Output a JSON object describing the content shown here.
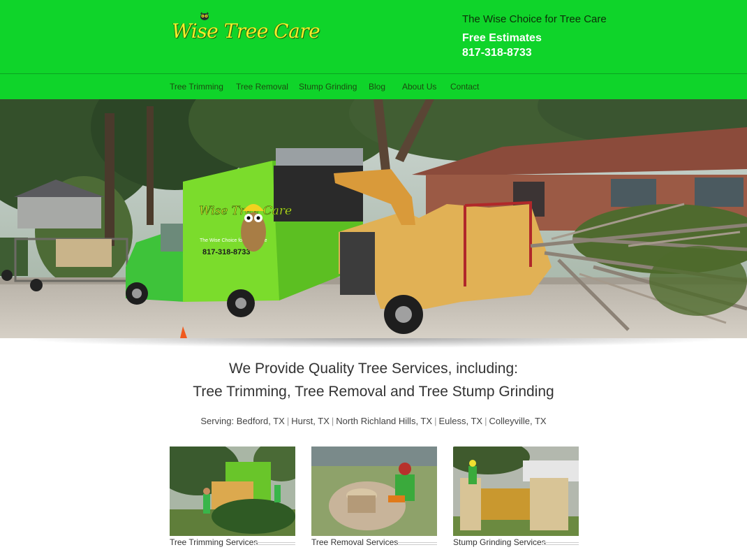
{
  "header": {
    "logo_text": "Wise Tree Care",
    "tagline": "The Wise Choice for Tree Care",
    "estimates": "Free Estimates",
    "phone": "817-318-8733"
  },
  "nav": {
    "items": [
      {
        "label": "Tree Trimming"
      },
      {
        "label": "Tree Removal"
      },
      {
        "label": "Stump Grinding"
      },
      {
        "label": "Blog"
      },
      {
        "label": "About Us"
      },
      {
        "label": "Contact"
      }
    ]
  },
  "truck": {
    "brand": "Wise Tree Care",
    "slogan": "The Wise Choice for Tree Care",
    "phone": "817-318-8733"
  },
  "main": {
    "headline_1": "We Provide Quality Tree Services, including:",
    "headline_2": "Tree Trimming, Tree Removal and Tree Stump Grinding",
    "serving_prefix": "Serving: ",
    "cities": [
      "Bedford, TX",
      "Hurst, TX",
      "North Richland Hills, TX",
      "Euless, TX",
      "Colleyville, TX"
    ],
    "separator": "|"
  },
  "services": [
    {
      "label": "Tree Trimming Services"
    },
    {
      "label": "Tree Removal Services"
    },
    {
      "label": "Stump Grinding Services"
    }
  ],
  "colors": {
    "header_green": "#0fd42a",
    "logo_yellow": "#f3ef2a",
    "nav_text": "#1c4a10"
  }
}
